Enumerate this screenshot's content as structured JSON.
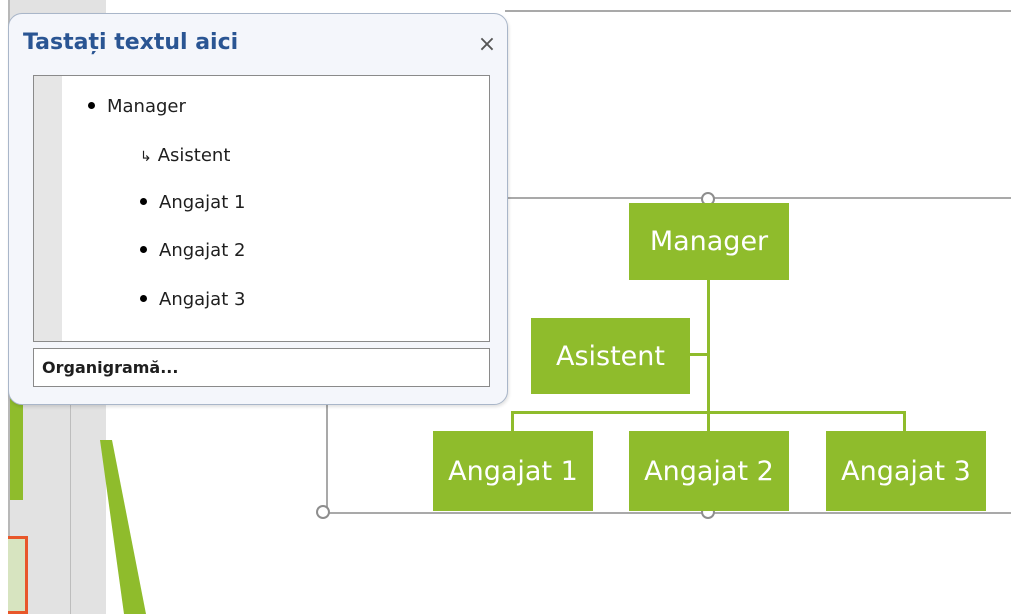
{
  "text_pane": {
    "title": "Tastați textul aici",
    "close_glyph": "×",
    "items": [
      {
        "label": "Manager",
        "level": 0,
        "marker": "bullet"
      },
      {
        "label": "Asistent",
        "level": 1,
        "marker": "assistant-arrow"
      },
      {
        "label": "Angajat 1",
        "level": 1,
        "marker": "bullet"
      },
      {
        "label": "Angajat 2",
        "level": 1,
        "marker": "bullet"
      },
      {
        "label": "Angajat 3",
        "level": 1,
        "marker": "bullet"
      }
    ],
    "footer_label": "Organigramă..."
  },
  "org_chart": {
    "manager": "Manager",
    "assistant": "Asistent",
    "employees": [
      "Angajat 1",
      "Angajat 2",
      "Angajat 3"
    ]
  },
  "colors": {
    "node_fill": "#8fbc2c",
    "node_text": "#ffffff",
    "pane_title": "#2a5593",
    "selection_border": "#a9a9a9",
    "accent_orange": "#e8572a"
  },
  "icons": {
    "close": "close-icon",
    "bullet": "bullet-icon",
    "assistant_marker": "assistant-arrow-icon",
    "resize_handle": "resize-handle-icon"
  }
}
